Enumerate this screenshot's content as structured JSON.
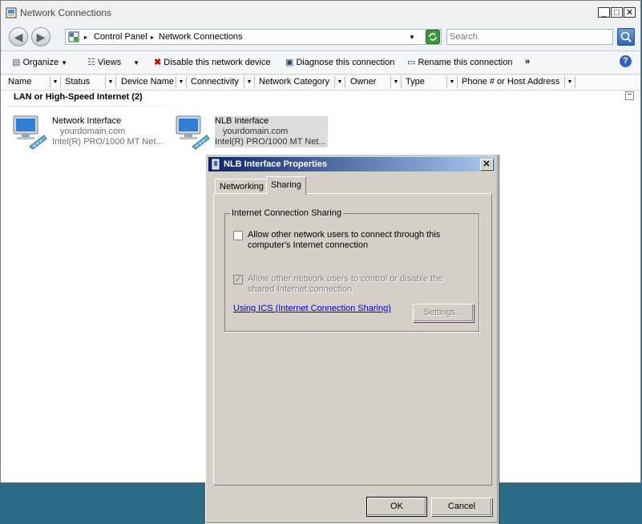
{
  "window": {
    "title": "Network Connections",
    "controls": {
      "minimize": "_",
      "maximize": "□",
      "close": "✕"
    }
  },
  "nav": {
    "back": "◀",
    "forward": "▶",
    "breadcrumb": [
      "Control Panel",
      "Network Connections"
    ],
    "separator": "▸",
    "search_placeholder": "Search"
  },
  "toolbar": {
    "organize": "Organize",
    "views": "Views",
    "disable": "Disable this network device",
    "diagnose": "Diagnose this connection",
    "rename": "Rename this connection",
    "more": "»",
    "help": "?"
  },
  "columns": [
    "Name",
    "Status",
    "Device Name",
    "Connectivity",
    "Network Category",
    "Owner",
    "Type",
    "Phone # or Host Address"
  ],
  "group": {
    "header": "LAN or High-Speed Internet (2)",
    "collapse": "−"
  },
  "connections": [
    {
      "name": "Network Interface",
      "domain": "yourdomain.com",
      "device": "Intel(R) PRO/1000 MT Net..."
    },
    {
      "name": "NLB Interface",
      "domain": "yourdomain.com",
      "device": "Intel(R) PRO/1000 MT Net..."
    }
  ],
  "dialog": {
    "title": "NLB Interface Properties",
    "close": "✕",
    "tabs": [
      "Networking",
      "Sharing"
    ],
    "active_tab": "Sharing",
    "groupbox_title": "Internet Connection Sharing",
    "allow_connect_line1": "Allow other network users to connect through this",
    "allow_connect_line2": "computer's Internet connection",
    "allow_connect_checked": false,
    "allow_control_line1": "Allow other network users to control or disable the",
    "allow_control_line2": "shared Internet connection",
    "allow_control_checked": true,
    "ics_link": "Using ICS (Internet Connection Sharing)",
    "settings_button": "Settings...",
    "ok_button": "OK",
    "cancel_button": "Cancel"
  },
  "colors": {
    "desktop": "#2b6a86",
    "dialog_title_start": "#0a246a",
    "dialog_title_end": "#a6caf0",
    "link": "#0000cc"
  }
}
